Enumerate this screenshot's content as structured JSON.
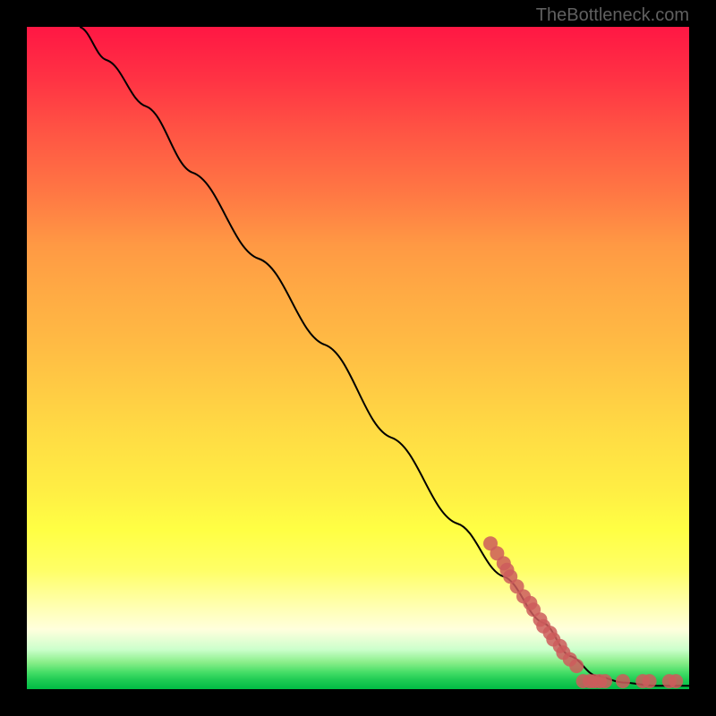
{
  "attribution": "TheBottleneck.com",
  "chart_data": {
    "type": "line",
    "title": "",
    "xlabel": "",
    "ylabel": "",
    "xlim": [
      0,
      100
    ],
    "ylim": [
      0,
      100
    ],
    "curve": {
      "description": "Descending curve from top-left to bottom-right, starting steep and flattening at bottom",
      "points": [
        {
          "x": 8,
          "y": 100
        },
        {
          "x": 12,
          "y": 95
        },
        {
          "x": 18,
          "y": 88
        },
        {
          "x": 25,
          "y": 78
        },
        {
          "x": 35,
          "y": 65
        },
        {
          "x": 45,
          "y": 52
        },
        {
          "x": 55,
          "y": 38
        },
        {
          "x": 65,
          "y": 25
        },
        {
          "x": 72,
          "y": 17
        },
        {
          "x": 78,
          "y": 10
        },
        {
          "x": 82,
          "y": 5
        },
        {
          "x": 86,
          "y": 2
        },
        {
          "x": 90,
          "y": 1
        },
        {
          "x": 95,
          "y": 0.5
        },
        {
          "x": 100,
          "y": 0.5
        }
      ]
    },
    "scatter_points": [
      {
        "x": 70,
        "y": 22
      },
      {
        "x": 71,
        "y": 20.5
      },
      {
        "x": 72,
        "y": 19
      },
      {
        "x": 72.5,
        "y": 18
      },
      {
        "x": 73,
        "y": 17
      },
      {
        "x": 74,
        "y": 15.5
      },
      {
        "x": 75,
        "y": 14
      },
      {
        "x": 76,
        "y": 13
      },
      {
        "x": 76.5,
        "y": 12
      },
      {
        "x": 77.5,
        "y": 10.5
      },
      {
        "x": 78,
        "y": 9.5
      },
      {
        "x": 79,
        "y": 8.5
      },
      {
        "x": 79.5,
        "y": 7.5
      },
      {
        "x": 80.5,
        "y": 6.5
      },
      {
        "x": 81,
        "y": 5.5
      },
      {
        "x": 82,
        "y": 4.5
      },
      {
        "x": 83,
        "y": 3.5
      },
      {
        "x": 84,
        "y": 1.2
      },
      {
        "x": 85,
        "y": 1.2
      },
      {
        "x": 85.7,
        "y": 1.2
      },
      {
        "x": 86.5,
        "y": 1.2
      },
      {
        "x": 87.3,
        "y": 1.2
      },
      {
        "x": 90,
        "y": 1.2
      },
      {
        "x": 93,
        "y": 1.2
      },
      {
        "x": 94,
        "y": 1.2
      },
      {
        "x": 97,
        "y": 1.2
      },
      {
        "x": 98,
        "y": 1.2
      }
    ]
  }
}
